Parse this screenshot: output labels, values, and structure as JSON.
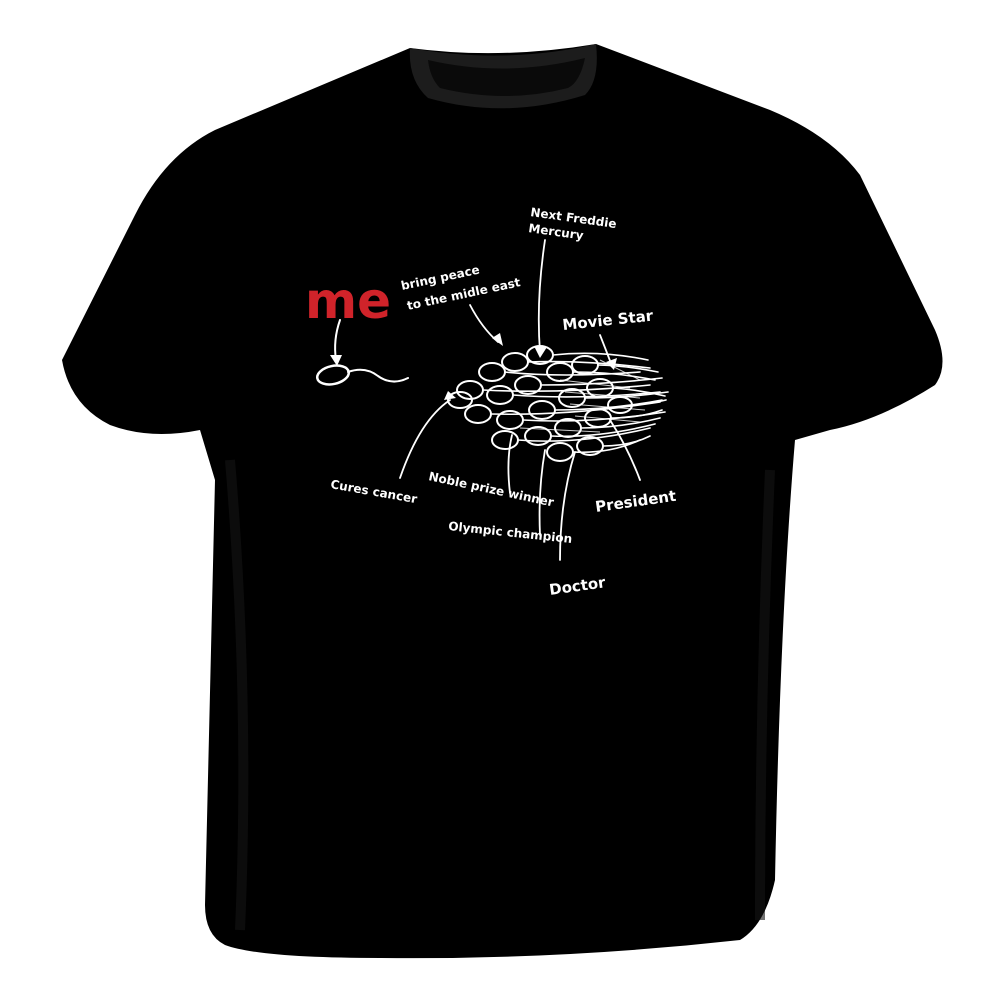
{
  "shirt": {
    "color": "#000000",
    "collar_color": "#1c1c1c",
    "print_color": "#ffffff",
    "accent_color": "#d0232a"
  },
  "print": {
    "me_label": "me",
    "labels": {
      "freddie_line1": "Next Freddie",
      "freddie_line2": "Mercury",
      "peace_line1": "bring peace",
      "peace_line2": "to the midle east",
      "movie_star": "Movie Star",
      "cures_cancer": "Cures cancer",
      "nobel": "Noble prize winner",
      "president": "President",
      "olympic": "Olympic champion",
      "doctor": "Doctor"
    }
  }
}
